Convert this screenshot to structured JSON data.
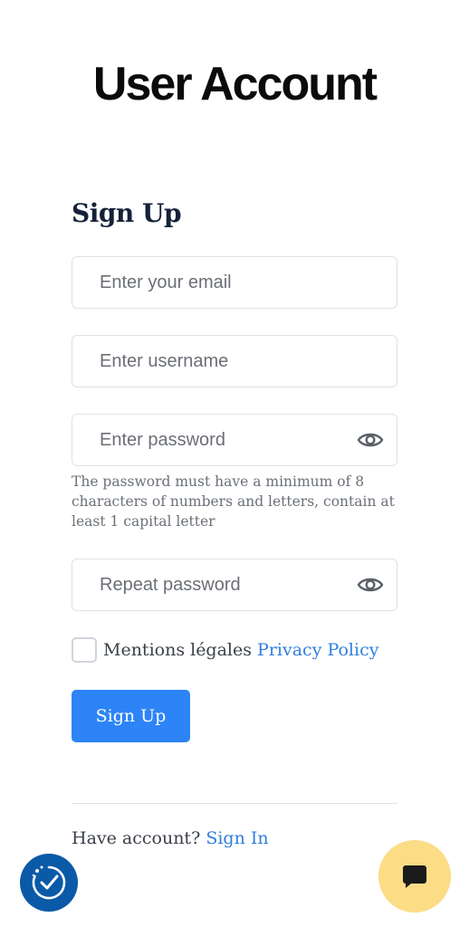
{
  "header": {
    "title": "User Account"
  },
  "form": {
    "heading": "Sign Up",
    "email": {
      "placeholder": "Enter your email",
      "value": ""
    },
    "username": {
      "placeholder": "Enter username",
      "value": ""
    },
    "password": {
      "placeholder": "Enter password",
      "value": "",
      "icon": "eye-icon",
      "hint": "The password must have a minimum of 8 characters of numbers and letters, contain at least 1 capital letter"
    },
    "repeat_password": {
      "placeholder": "Repeat password",
      "value": "",
      "icon": "eye-icon"
    },
    "legal": {
      "checked": false,
      "label": "Mentions légales",
      "link_label": "Privacy Policy"
    },
    "submit_label": "Sign Up"
  },
  "footer": {
    "prompt": "Have account?",
    "link_label": "Sign In"
  },
  "floating": {
    "left_icon": "accessibility-check-icon",
    "right_icon": "chat-icon"
  },
  "colors": {
    "primary": "#2d84f7",
    "link": "#2f7ee0",
    "heading": "#14213a",
    "chat_fab": "#fcdc85",
    "left_fab": "#0a5aa8"
  }
}
